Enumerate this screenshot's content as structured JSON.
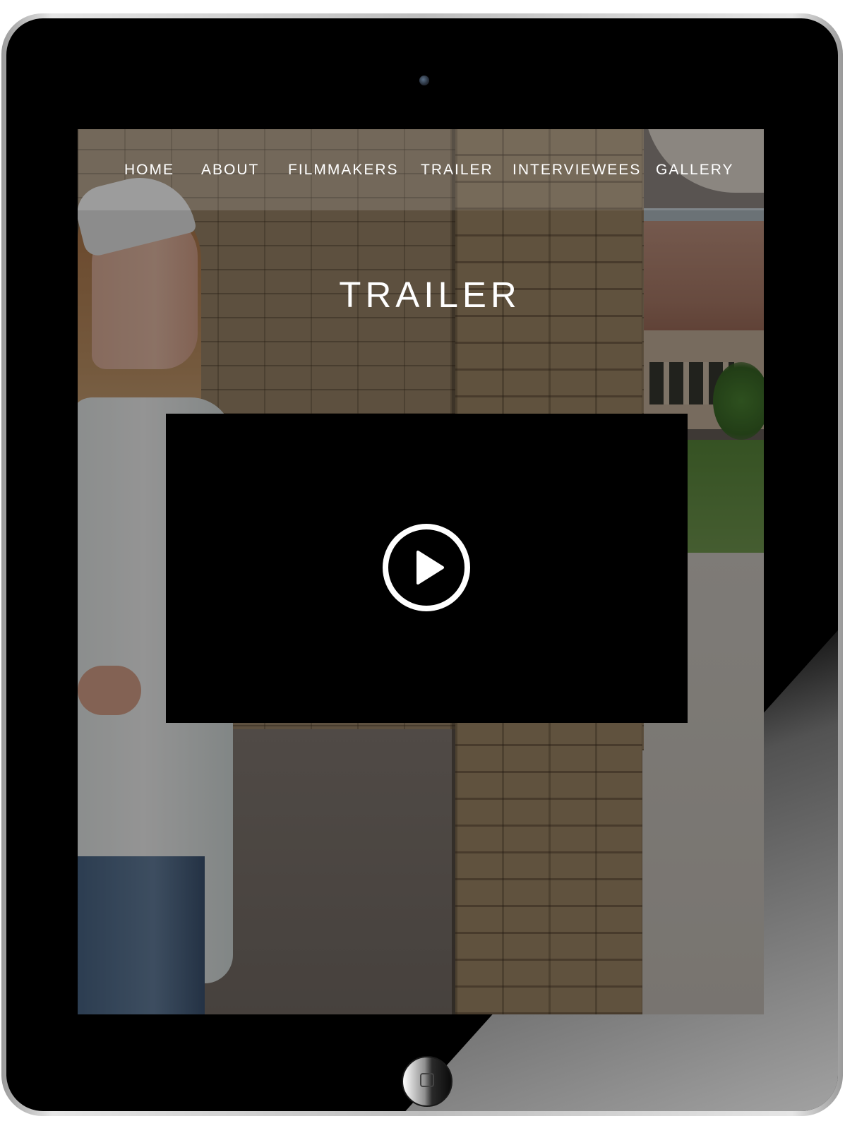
{
  "nav": {
    "items": [
      {
        "label": "HOME"
      },
      {
        "label": "ABOUT"
      },
      {
        "label": "FILMMAKERS"
      },
      {
        "label": "TRAILER"
      },
      {
        "label": "INTERVIEWEES"
      },
      {
        "label": "GALLERY"
      }
    ]
  },
  "page": {
    "title": "TRAILER"
  },
  "video": {
    "play_icon": "play-circle-icon"
  },
  "colors": {
    "nav_text": "#ffffff",
    "title_text": "#ffffff",
    "video_background": "#000000",
    "device_bezel": "#000000"
  }
}
